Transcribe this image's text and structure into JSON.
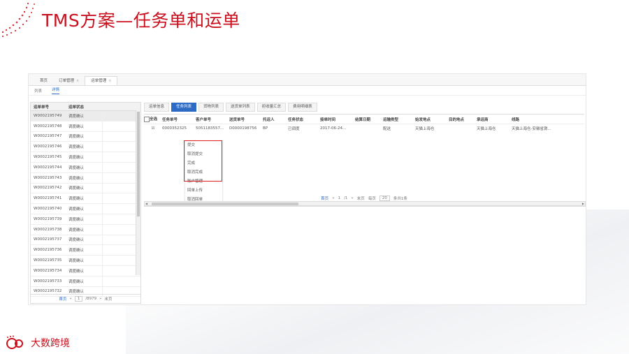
{
  "slide_title": "TMS方案—任务单和运单",
  "brand": {
    "name": "大数跨境",
    "accent": "#c8101e"
  },
  "tabs": [
    {
      "label": "首页"
    },
    {
      "label": "订单管理",
      "close": "×"
    },
    {
      "label": "运单管理",
      "close": "×"
    }
  ],
  "subtabs": [
    "列表",
    "详情"
  ],
  "left_table": {
    "headers": [
      "运单单号",
      "运单状态"
    ],
    "rows": [
      {
        "no": "W0002195749",
        "status": "调度确认"
      },
      {
        "no": "W0002195748",
        "status": "调度确认"
      },
      {
        "no": "W0002195747",
        "status": "调度确认"
      },
      {
        "no": "W0002195746",
        "status": "调度确认"
      },
      {
        "no": "W0002195745",
        "status": "调度确认"
      },
      {
        "no": "W0002195744",
        "status": "调度确认"
      },
      {
        "no": "W0002195743",
        "status": "调度确认"
      },
      {
        "no": "W0002195742",
        "status": "调度确认"
      },
      {
        "no": "W0002195741",
        "status": "调度确认"
      },
      {
        "no": "W0002195740",
        "status": "调度确认"
      },
      {
        "no": "W0002195739",
        "status": "调度确认"
      },
      {
        "no": "W0002195738",
        "status": "调度确认"
      },
      {
        "no": "W0002195737",
        "status": "调度确认"
      },
      {
        "no": "W0002195736",
        "status": "调度确认"
      },
      {
        "no": "W0002195735",
        "status": "调度确认"
      },
      {
        "no": "W0002195734",
        "status": "调度确认"
      },
      {
        "no": "W0002195733",
        "status": "调度确认"
      },
      {
        "no": "W0002195732",
        "status": "调度确认"
      }
    ],
    "pager": {
      "first": "首页",
      "prev": "«",
      "page": "1",
      "total": "/8979",
      "next": "»",
      "last": "末页"
    }
  },
  "right_buttons": [
    "运单信息",
    "任务列表",
    "货物列表",
    "送货单列表",
    "拒收量汇总",
    "费用明细表"
  ],
  "grid": {
    "headers": [
      "全选",
      "任务单号",
      "客户单号",
      "送货单号",
      "托运人",
      "任务状态",
      "接单时间",
      "结算日期",
      "运输类型",
      "始发地点",
      "目的地点",
      "承运商",
      "线路"
    ],
    "row": [
      "0000352325",
      "5051183557...",
      "D0000198756",
      "BP",
      "已调度",
      "2017-06-24...",
      "",
      "配送",
      "天猫上海仓",
      "",
      "天猫上海仓",
      "天猫上海仓-安徽省滁..."
    ],
    "context_menu": [
      "提交",
      "取消提交",
      "完成",
      "取消完成",
      "账户管理",
      "回单上传",
      "取消回单"
    ]
  },
  "right_pager": {
    "first": "首页",
    "prev": "«",
    "page": "1",
    "total": "/1",
    "next": "»",
    "last": "末页",
    "per_page_label": "每页",
    "per_page": "20",
    "count_text": "条共1条"
  }
}
